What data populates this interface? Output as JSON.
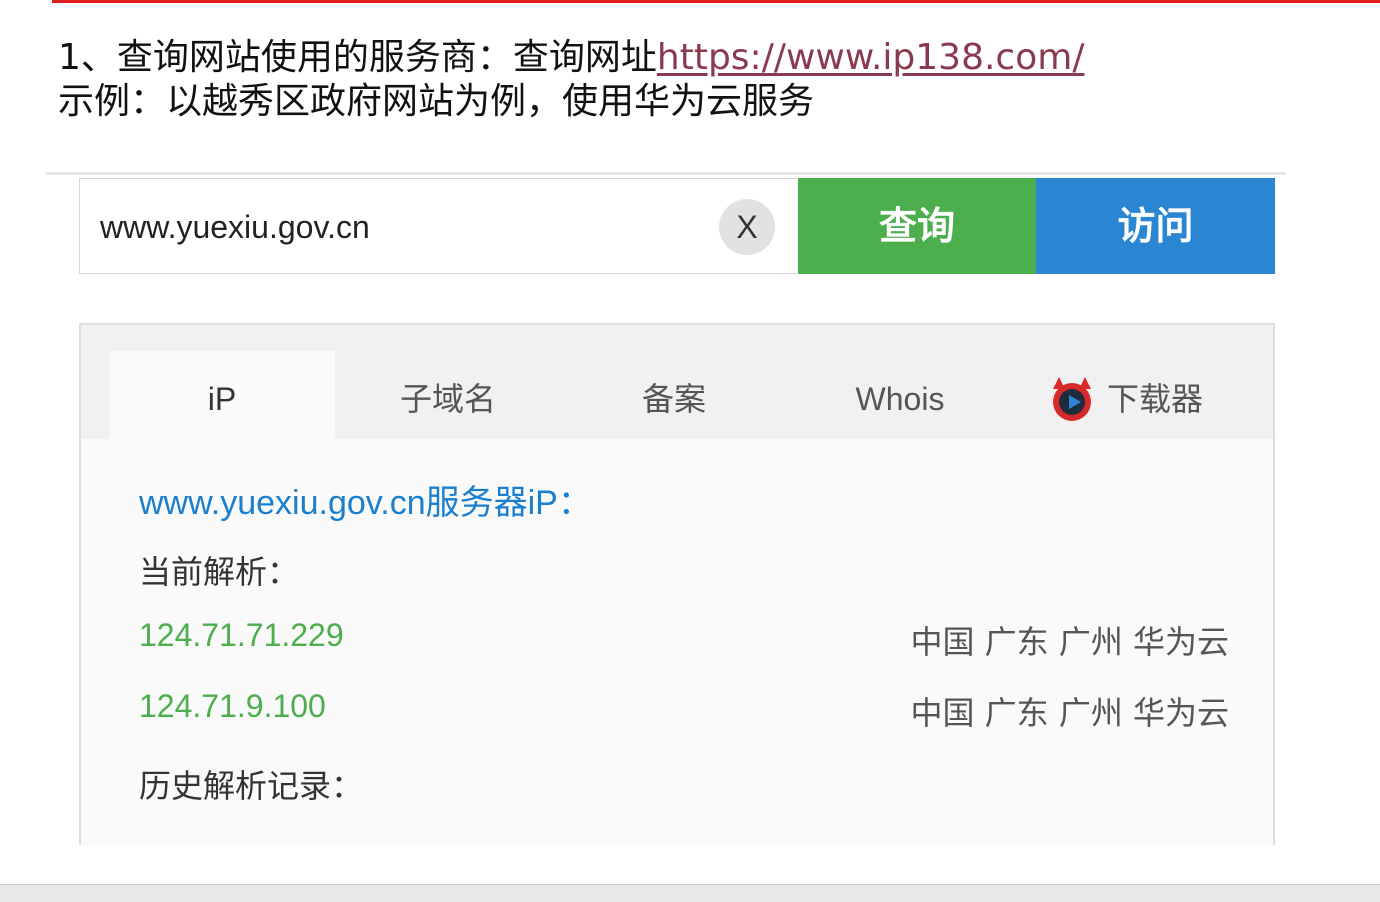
{
  "instructions": {
    "line1_prefix": "1、查询网站使用的服务商：查询网址",
    "line1_link": "https://www.ip138.com/",
    "line2": "示例：以越秀区政府网站为例，使用华为云服务"
  },
  "search": {
    "value": "www.yuexiu.gov.cn",
    "clear_label": "X",
    "query_label": "查询",
    "visit_label": "访问"
  },
  "colors": {
    "query_button": "#4cae4c",
    "visit_button": "#2a86d3",
    "title_link": "#1a7fcf",
    "ip_text": "#4cae4c",
    "top_rule": "#e02020"
  },
  "tabs": [
    {
      "label": "iP",
      "active": true
    },
    {
      "label": "子域名",
      "active": false
    },
    {
      "label": "备案",
      "active": false
    },
    {
      "label": "Whois",
      "active": false
    },
    {
      "label": "下载器",
      "icon": "downloader-devil-icon",
      "active": false
    }
  ],
  "result": {
    "title": "www.yuexiu.gov.cn服务器iP：",
    "current_label": "当前解析：",
    "history_label": "历史解析记录：",
    "records": [
      {
        "ip": "124.71.71.229",
        "location": "中国 广东 广州 华为云"
      },
      {
        "ip": "124.71.9.100",
        "location": "中国 广东 广州 华为云"
      }
    ]
  }
}
